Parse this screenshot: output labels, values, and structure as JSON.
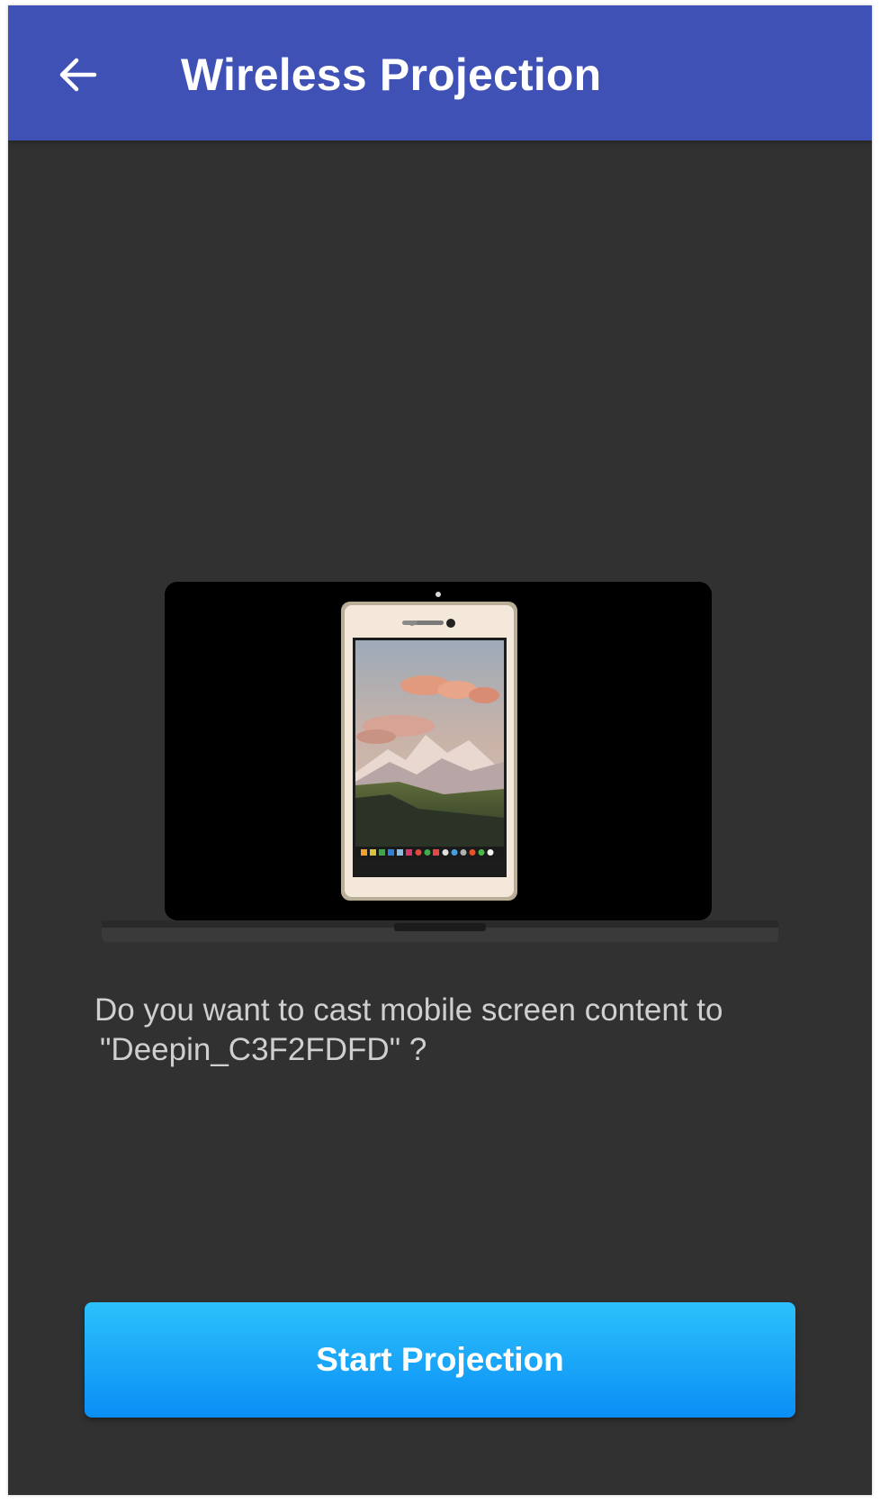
{
  "appbar": {
    "title": "Wireless Projection",
    "back_icon": "arrow-left-icon"
  },
  "illustration": {
    "description_icon": "laptop-with-phone-illustration",
    "phone_wallpaper": "mountain-sunset"
  },
  "message": {
    "line1": "Do you want to cast mobile screen content to",
    "line2": "\"Deepin_C3F2FDFD\" ?"
  },
  "action": {
    "start_label": "Start Projection"
  },
  "colors": {
    "appbar": "#3F51B5",
    "background": "#313131",
    "button_top": "#2CC1FC",
    "button_bottom": "#0A8EF5",
    "message_text": "#CFCFCF"
  }
}
